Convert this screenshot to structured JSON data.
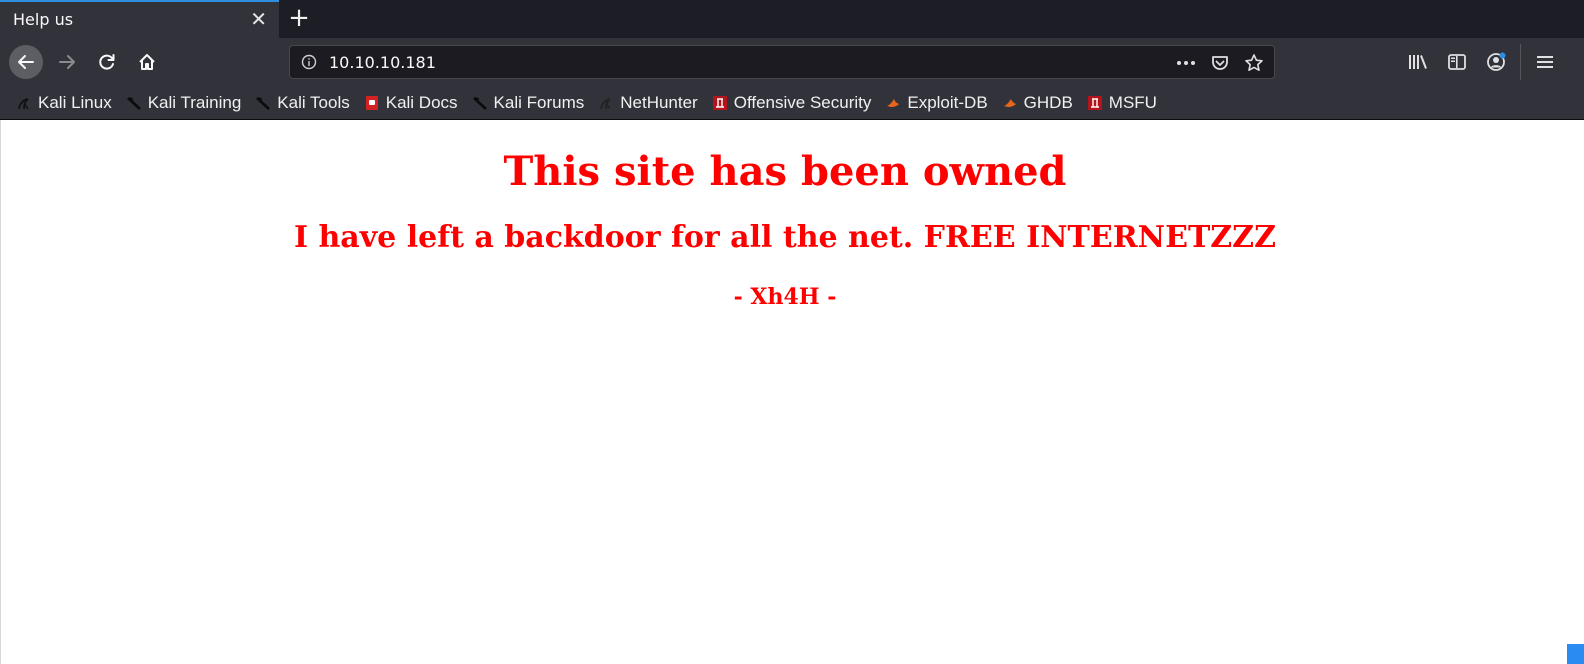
{
  "tab": {
    "title": "Help us",
    "close_glyph": "✕",
    "newtab_glyph": "+"
  },
  "url": {
    "address": "10.10.10.181"
  },
  "bookmarks": [
    {
      "label": "Kali Linux",
      "icon": "kali-dragon-icon"
    },
    {
      "label": "Kali Training",
      "icon": "kali-dragon-icon"
    },
    {
      "label": "Kali Tools",
      "icon": "kali-dragon-icon"
    },
    {
      "label": "Kali Docs",
      "icon": "kali-docs-icon"
    },
    {
      "label": "Kali Forums",
      "icon": "kali-dragon-icon"
    },
    {
      "label": "NetHunter",
      "icon": "nethunter-icon"
    },
    {
      "label": "Offensive Security",
      "icon": "offsec-icon"
    },
    {
      "label": "Exploit-DB",
      "icon": "exploitdb-icon"
    },
    {
      "label": "GHDB",
      "icon": "exploitdb-icon"
    },
    {
      "label": "MSFU",
      "icon": "offsec-icon"
    }
  ],
  "page": {
    "heading": "This site has been owned",
    "subheading": "I have left a backdoor for all the net. FREE INTERNETZZZ",
    "signature": "- Xh4H -"
  },
  "colors": {
    "page_text": "#ff0000",
    "chrome_dark": "#32333a",
    "tab_accent": "#2f8ee0"
  }
}
